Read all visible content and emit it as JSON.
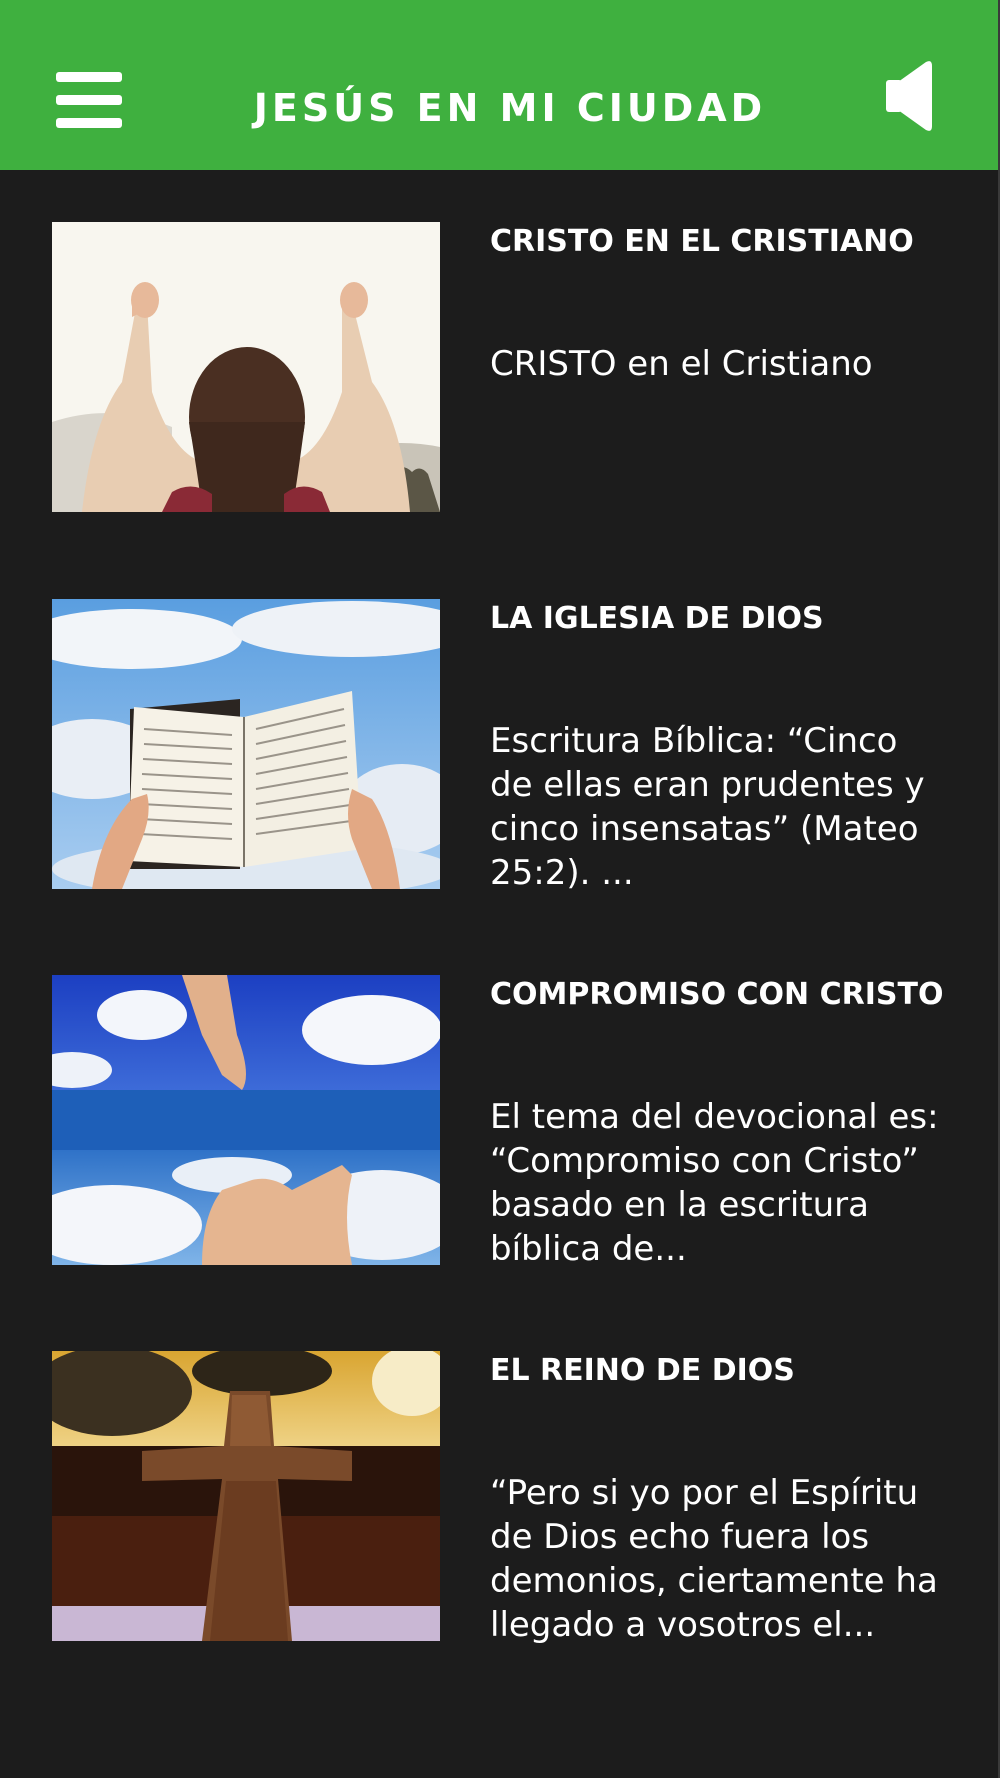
{
  "header": {
    "title": "JESÚS EN MI CIUDAD",
    "menu_icon": "hamburger-menu-icon",
    "sound_icon": "speaker-icon"
  },
  "colors": {
    "header_bg": "#3fb03f",
    "page_bg": "#1c1c1c",
    "text": "#ffffff"
  },
  "items": [
    {
      "title": "CRISTO EN EL CRISTIANO",
      "description": "CRISTO en el Cristiano",
      "image": "raised-hands-image"
    },
    {
      "title": "LA IGLESIA DE DIOS",
      "description": "Escritura Bíblica: “Cinco de ellas eran prudentes y cinco insensatas” (Mateo 25:2). ...",
      "image": "open-bible-sky-image"
    },
    {
      "title": "COMPROMISO CON CRISTO",
      "description": "El tema del devocional es: “Compromiso con Cristo” basado en la escritura bíblica de...",
      "image": "reaching-hands-sky-image"
    },
    {
      "title": "EL REINO DE DIOS",
      "description": "“Pero si yo por el Espíritu de Dios echo fuera los demonios, ciertamente ha llegado a vosotros el...",
      "image": "wooden-cross-image"
    }
  ]
}
